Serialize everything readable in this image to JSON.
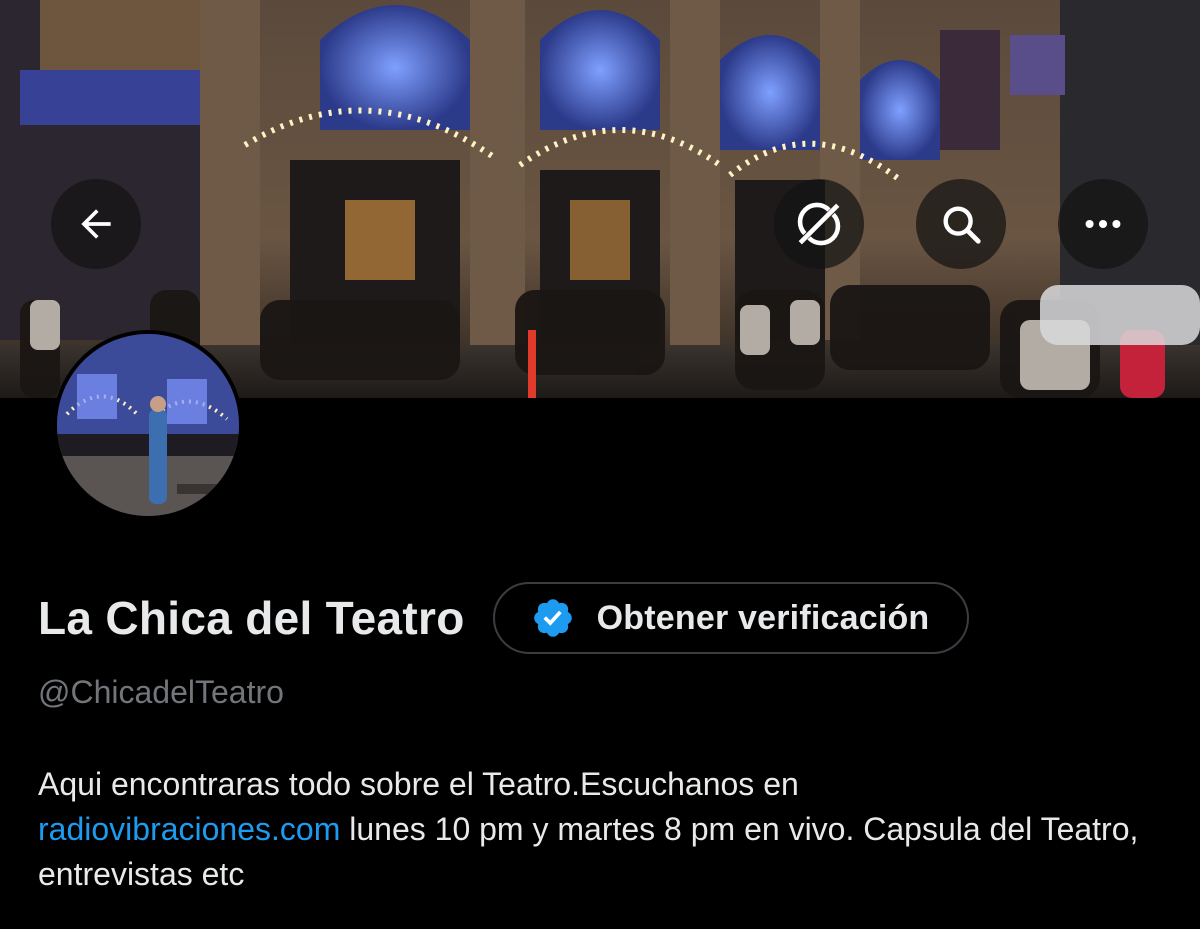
{
  "header": {
    "back_icon": "arrow-left-icon",
    "grok_icon": "grok-slash-icon",
    "search_icon": "search-icon",
    "more_icon": "more-dots-icon"
  },
  "profile": {
    "display_name": "La Chica del Teatro",
    "verify_button_label": "Obtener verificación",
    "verify_badge_color": "#1d9bf0",
    "handle": "@ChicadelTeatro",
    "bio": {
      "line_prefix": "Aqui encontraras todo sobre el Teatro.Escuchanos en",
      "link_text": "radiovibraciones.com",
      "line_suffix": " lunes 10 pm y martes 8 pm en vivo. Capsula del Teatro, entrevistas etc"
    }
  },
  "colors": {
    "background": "#000000",
    "primary_text": "#e7e9ea",
    "secondary_text": "#71767b",
    "link": "#1d9bf0"
  }
}
